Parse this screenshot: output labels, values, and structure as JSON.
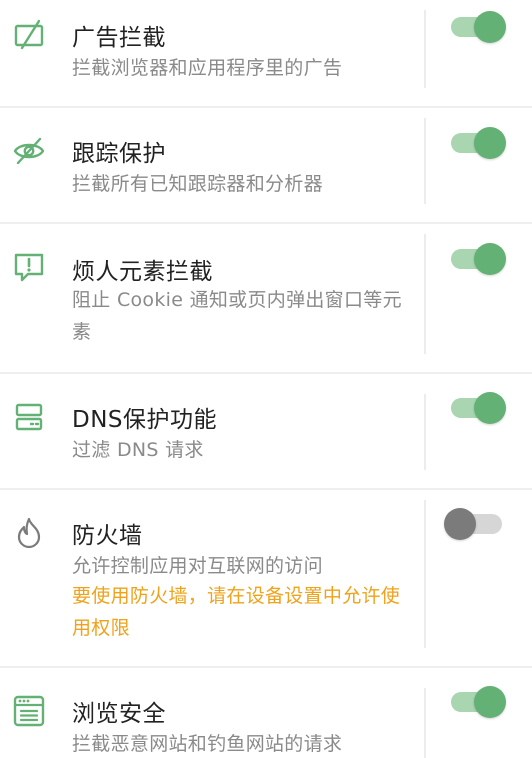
{
  "colors": {
    "accent": "#63b175",
    "warning": "#f0a21b",
    "title": "#222222",
    "description": "#8a8a8a"
  },
  "features": [
    {
      "icon": "ad-block-icon",
      "title": "广告拦截",
      "description": "拦截浏览器和应用程序里的广告",
      "enabled": true
    },
    {
      "icon": "tracking-protection-icon",
      "title": "跟踪保护",
      "description": "拦截所有已知跟踪器和分析器",
      "enabled": true
    },
    {
      "icon": "annoyance-icon",
      "title": "烦人元素拦截",
      "description": "阻止 Cookie 通知或页内弹出窗口等元素",
      "enabled": true
    },
    {
      "icon": "dns-icon",
      "title": "DNS保护功能",
      "description": "过滤 DNS 请求",
      "enabled": true
    },
    {
      "icon": "firewall-icon",
      "title": "防火墙",
      "description": "允许控制应用对互联网的访问",
      "warning": "要使用防火墙，请在设备设置中允许使用权限",
      "enabled": false
    },
    {
      "icon": "browsing-security-icon",
      "title": "浏览安全",
      "description": "拦截恶意网站和钓鱼网站的请求",
      "enabled": true
    }
  ]
}
